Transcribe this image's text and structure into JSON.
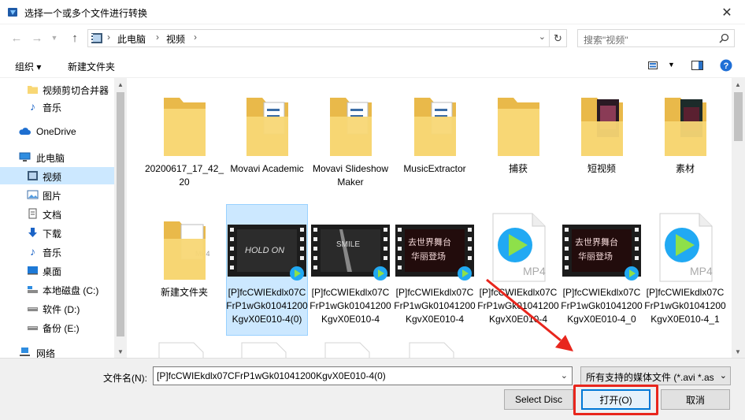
{
  "window": {
    "title": "选择一个或多个文件进行转换",
    "close_glyph": "✕"
  },
  "address": {
    "crumbs": [
      "此电脑",
      "视频"
    ],
    "search_placeholder": "搜索\"视频\""
  },
  "toolbar": {
    "organize_label": "组织 ▾",
    "new_folder_label": "新建文件夹"
  },
  "sidebar": {
    "items": [
      {
        "label": "视频剪切合并器",
        "icon": "folder-icon"
      },
      {
        "label": "音乐",
        "icon": "music-icon"
      },
      {
        "label": "OneDrive",
        "icon": "cloud-icon"
      },
      {
        "label": "此电脑",
        "icon": "computer-icon"
      },
      {
        "label": "视频",
        "icon": "video-folder-icon",
        "selected": true
      },
      {
        "label": "图片",
        "icon": "pictures-icon"
      },
      {
        "label": "文档",
        "icon": "documents-icon"
      },
      {
        "label": "下载",
        "icon": "download-icon"
      },
      {
        "label": "音乐",
        "icon": "music-icon"
      },
      {
        "label": "桌面",
        "icon": "desktop-icon"
      },
      {
        "label": "本地磁盘 (C:)",
        "icon": "drive-icon"
      },
      {
        "label": "软件 (D:)",
        "icon": "drive-icon"
      },
      {
        "label": "备份 (E:)",
        "icon": "drive-icon"
      },
      {
        "label": "网络",
        "icon": "network-icon"
      }
    ]
  },
  "files": [
    {
      "name": "20200617_17_42_20",
      "kind": "folder"
    },
    {
      "name": "Movavi Academic",
      "kind": "folder-doc"
    },
    {
      "name": "Movavi Slideshow Maker",
      "kind": "folder-doc"
    },
    {
      "name": "MusicExtractor",
      "kind": "folder-doc"
    },
    {
      "name": "捕获",
      "kind": "folder-plain"
    },
    {
      "name": "短视频",
      "kind": "folder-photo"
    },
    {
      "name": "素材",
      "kind": "folder-photo2"
    },
    {
      "name": "新建文件夹",
      "kind": "folder-mp4"
    },
    {
      "name": "[P]fcCWIEkdlx07CFrP1wGk01041200KgvX0E010-4(0)",
      "kind": "video-holdon",
      "selected": true
    },
    {
      "name": "[P]fcCWIEkdlx07CFrP1wGk01041200KgvX0E010-4",
      "kind": "video-smile"
    },
    {
      "name": "[P]fcCWIEkdlx07CFrP1wGk01041200KgvX0E010-4",
      "kind": "video-red"
    },
    {
      "name": "[P]fcCWIEkdlx07CFrP1wGk01041200KgvX0E010-4",
      "kind": "mp4"
    },
    {
      "name": "[P]fcCWIEkdlx07CFrP1wGk01041200KgvX0E010-4_0",
      "kind": "video-red"
    },
    {
      "name": "[P]fcCWIEkdlx07CFrP1wGk01041200KgvX0E010-4_1",
      "kind": "mp4"
    }
  ],
  "overlay_text": {
    "holdon": "HOLD ON",
    "smile": "SMILE",
    "red_line1": "去世界舞台",
    "red_line2": "华丽登场",
    "mp4": "MP4"
  },
  "footer": {
    "filename_label": "文件名(N):",
    "filename_value": "[P]fcCWIEkdlx07CFrP1wGk01041200KgvX0E010-4(0)",
    "filetype_value": "所有支持的媒体文件 (*.avi *.as",
    "select_disc_label": "Select Disc",
    "open_label": "打开(O)",
    "cancel_label": "取消"
  },
  "colors": {
    "selection": "#cce8ff",
    "folder": "#f8d775",
    "folder_dark": "#e9b94a",
    "highlight": "#e8261d",
    "accent": "#0078d7"
  }
}
